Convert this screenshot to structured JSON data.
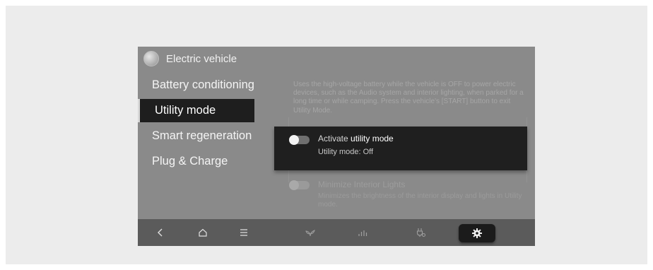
{
  "header": {
    "title": "Electric vehicle",
    "app_icon": "ev-icon"
  },
  "menu": {
    "items": [
      {
        "label": "Battery conditioning",
        "active": false
      },
      {
        "label": "Utility mode",
        "active": true
      },
      {
        "label": "Smart regeneration",
        "active": false
      },
      {
        "label": "Plug & Charge",
        "active": false
      }
    ]
  },
  "content": {
    "description": "Uses the high-voltage battery while the vehicle is OFF to power electric devices, such as the Audio system and interior lighting, when parked for a long time or while camping. Press the vehicle's [START] button to exit Utility Mode.",
    "utility_toggle": {
      "label_prefix": "Activate ",
      "label_emphasis": "utility mode",
      "status": "Utility mode: Off"
    },
    "interior_lights": {
      "label": "Minimize Interior Lights",
      "description": "Minimizes the brightness of the interior display and lights in Utility mode."
    }
  },
  "bottom_bar": {
    "icons": [
      "back-icon",
      "home-icon",
      "menu-icon",
      "eco-leaf-icon",
      "energy-bars-icon",
      "charging-plug-icon",
      "settings-gear-icon"
    ]
  },
  "colors": {
    "screen_bg": "#8a8a8a",
    "card_bg": "#1f1f1f",
    "bar_bg": "#5b5b5b"
  }
}
